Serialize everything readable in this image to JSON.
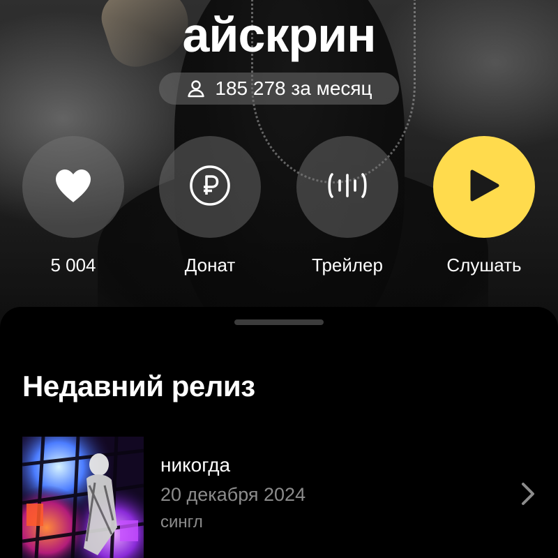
{
  "artist": {
    "name": "айскрин",
    "monthly_listeners": "185 278 за месяц",
    "listeners_icon": "person-icon"
  },
  "actions": [
    {
      "id": "like",
      "label": "5 004",
      "icon": "heart-icon"
    },
    {
      "id": "donate",
      "label": "Донат",
      "icon": "ruble-icon"
    },
    {
      "id": "trailer",
      "label": "Трейлер",
      "icon": "soundwave-icon"
    },
    {
      "id": "listen",
      "label": "Слушать",
      "icon": "play-icon"
    }
  ],
  "recent_release": {
    "section_title": "Недавний релиз",
    "title": "никогда",
    "date": "20 декабря 2024",
    "type": "сингл",
    "chevron_icon": "chevron-right-icon"
  },
  "colors": {
    "accent": "#ffdb4d",
    "sheet_background": "#000000",
    "secondary_text": "#8c8c8c",
    "button_background": "#6e6e6e"
  }
}
